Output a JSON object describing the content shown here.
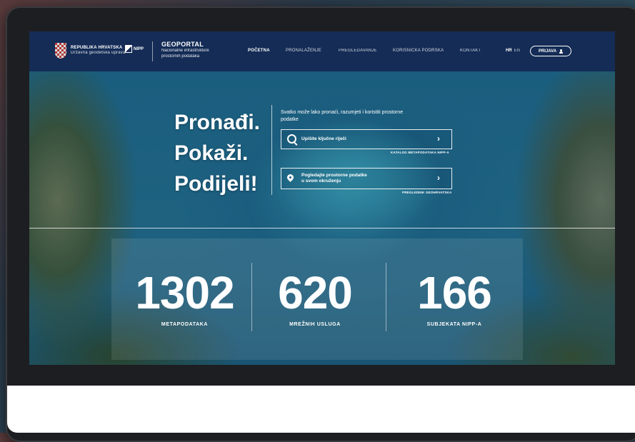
{
  "header": {
    "country": "REPUBLIKA HRVATSKA",
    "agency": "Državna geodetska uprava",
    "nipp": "NIPP",
    "geoportal_title": "GEOPORTAL",
    "geoportal_sub1": "Nacionalne infrastrukture",
    "geoportal_sub2": "prostornih podataka"
  },
  "menu": {
    "items": [
      "POČETNA",
      "PRONALAŽENJE",
      "PREGLEDAVANJE",
      "KORISNIČKA PODRŠKA",
      "KONTAKT"
    ],
    "active": "POČETNA"
  },
  "lang": {
    "hr": "HR",
    "en": "EN"
  },
  "login": {
    "label": "PRIJAVA"
  },
  "hero": {
    "line1": "Pronađi.",
    "line2": "Pokaži.",
    "line3": "Podijeli!",
    "intro": "Svatko može lako pronaći, razumjeti i koristiti prostorne podatke",
    "search_label": "Upišite ključne riječi",
    "search_caption": "KATALOG METAPODATAKA NIPP-A",
    "map_label_1": "Pogledajte prostorne podatke",
    "map_label_2": "u svom okruženju",
    "map_caption": "PREGLEDNIK GEOHRVATSKA"
  },
  "stats": [
    {
      "value": "1302",
      "label": "METAPODATAKA"
    },
    {
      "value": "620",
      "label": "MREŽNIH USLUGA"
    },
    {
      "value": "166",
      "label": "SUBJEKATA NIPP-A"
    }
  ],
  "colors": {
    "navbar": "#142c56",
    "frame": "#1d1e21"
  }
}
